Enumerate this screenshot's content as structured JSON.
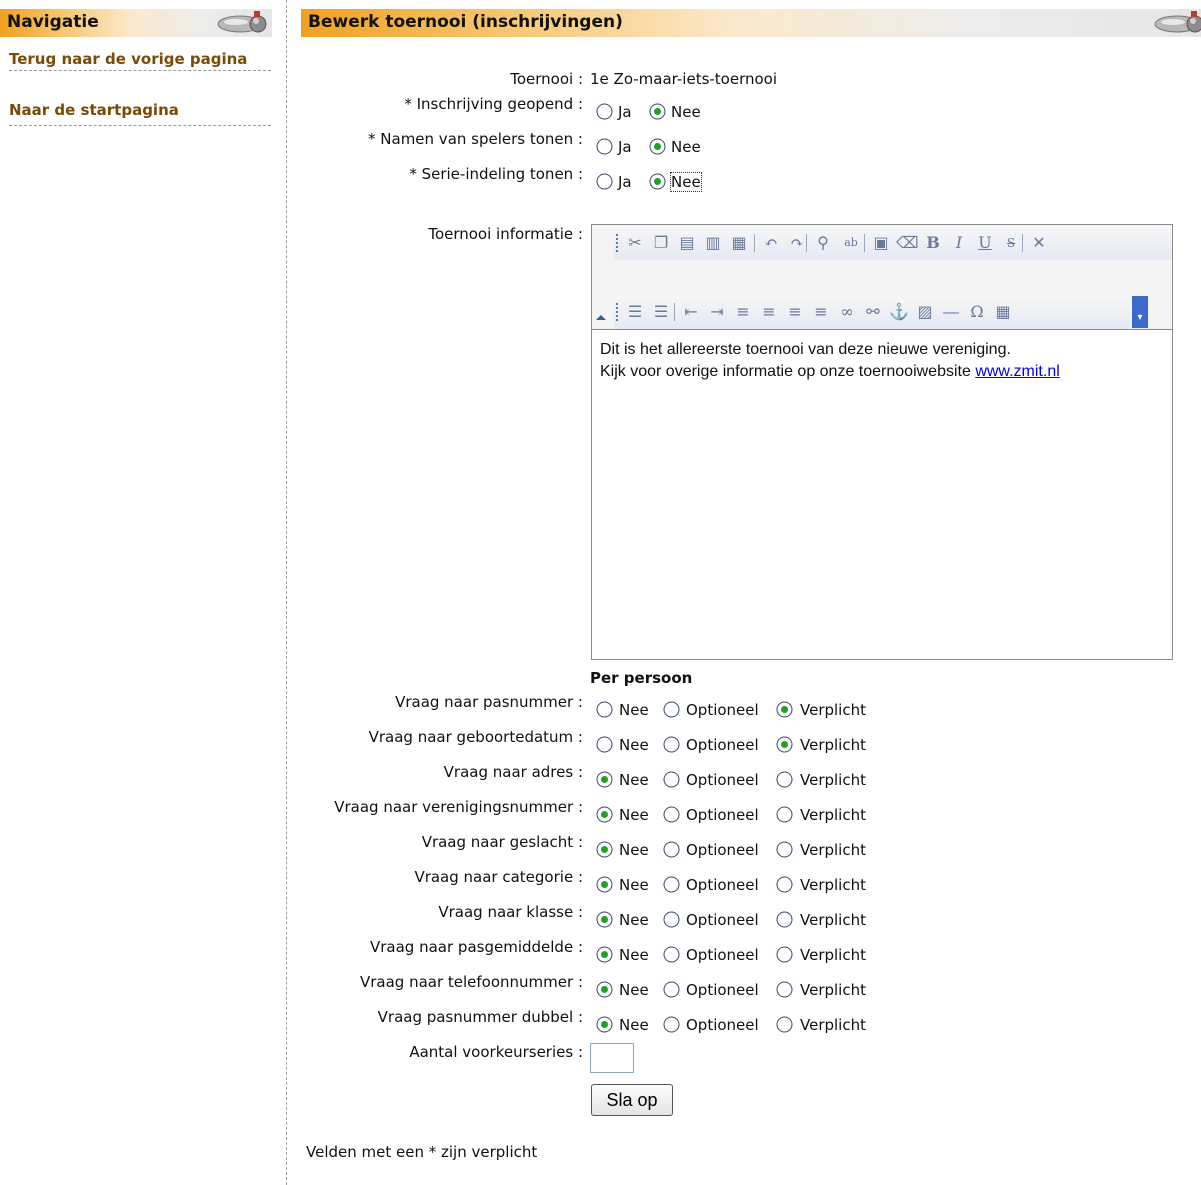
{
  "sidebar": {
    "title": "Navigatie",
    "links": [
      "Terug naar de vorige pagina",
      "Naar de startpagina"
    ]
  },
  "main": {
    "title": "Bewerk toernooi (inschrijvingen)",
    "tournament_label": "Toernooi :",
    "tournament_name": "1e Zo-maar-iets-toernooi",
    "settings": [
      {
        "label": "* Inschrijving geopend :",
        "options": [
          "Ja",
          "Nee"
        ],
        "selected": "Nee"
      },
      {
        "label": "* Namen van spelers tonen :",
        "options": [
          "Ja",
          "Nee"
        ],
        "selected": "Nee"
      },
      {
        "label": "* Serie-indeling tonen :",
        "options": [
          "Ja",
          "Nee"
        ],
        "selected": "Nee"
      }
    ],
    "info_label": "Toernooi informatie :",
    "editor": {
      "line1": "Dit is het allereerste toernooi van deze nieuwe vereniging.",
      "line2": "Kijk voor overige informatie op onze toernooiwebsite ",
      "link_text": "www.zmit.nl",
      "toolbar_row1": [
        "cut-icon",
        "copy-icon",
        "paste-icon",
        "paste-text-icon",
        "paste-word-icon",
        "undo-icon",
        "redo-icon",
        "find-icon",
        "replace-icon",
        "select-all-icon",
        "remove-format-icon",
        "bold-icon",
        "italic-icon",
        "underline-icon",
        "strikethrough-icon",
        "close-icon"
      ],
      "toolbar_row2": [
        "numbered-list-icon",
        "bulleted-list-icon",
        "outdent-icon",
        "indent-icon",
        "align-left-icon",
        "align-center-icon",
        "align-right-icon",
        "align-justify-icon",
        "link-icon",
        "unlink-icon",
        "anchor-icon",
        "image-icon",
        "horizontal-rule-icon",
        "special-char-icon",
        "table-icon"
      ]
    },
    "per_person_heading": "Per persoon",
    "question_options": [
      "Nee",
      "Optioneel",
      "Verplicht"
    ],
    "questions": [
      {
        "label": "Vraag naar pasnummer :",
        "selected": "Verplicht"
      },
      {
        "label": "Vraag naar geboortedatum :",
        "selected": "Verplicht"
      },
      {
        "label": "Vraag naar adres :",
        "selected": "Nee"
      },
      {
        "label": "Vraag naar verenigingsnummer :",
        "selected": "Nee"
      },
      {
        "label": "Vraag naar geslacht :",
        "selected": "Nee"
      },
      {
        "label": "Vraag naar categorie :",
        "selected": "Nee"
      },
      {
        "label": "Vraag naar klasse :",
        "selected": "Nee"
      },
      {
        "label": "Vraag naar pasgemiddelde :",
        "selected": "Nee"
      },
      {
        "label": "Vraag naar telefoonnummer :",
        "selected": "Nee"
      },
      {
        "label": "Vraag pasnummer dubbel :",
        "selected": "Nee"
      }
    ],
    "voorkeur_label": "Aantal voorkeurseries :",
    "voorkeur_value": "",
    "save_label": "Sla op",
    "footer_note": "Velden met een * zijn verplicht"
  }
}
